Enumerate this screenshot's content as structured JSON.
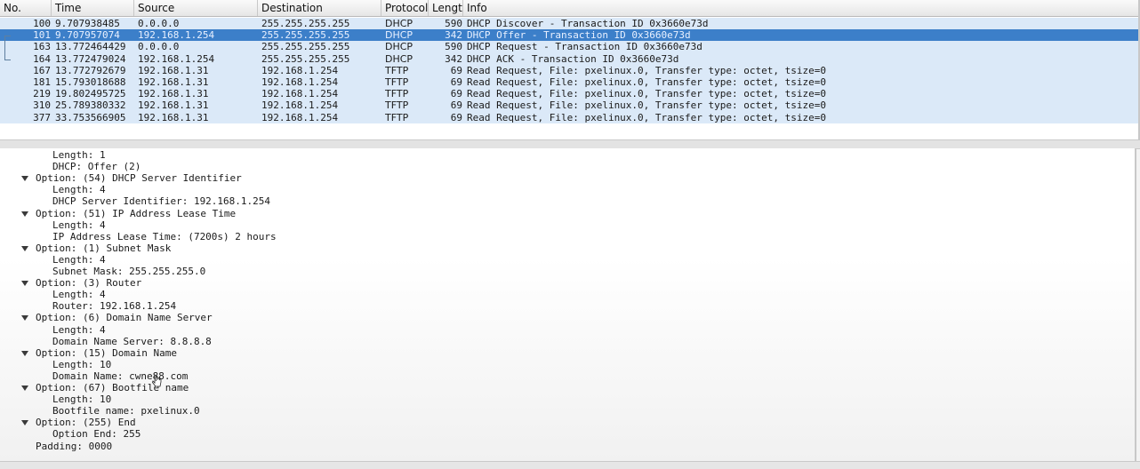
{
  "packet_list": {
    "columns": [
      "No.",
      "Time",
      "Source",
      "Destination",
      "Protocol",
      "Length",
      "Info"
    ],
    "rows": [
      {
        "no": "100",
        "time": "9.707938485",
        "src": "0.0.0.0",
        "dst": "255.255.255.255",
        "proto": "DHCP",
        "len": "590",
        "info": "DHCP Discover - Transaction ID 0x3660e73d"
      },
      {
        "no": "101",
        "time": "9.707957074",
        "src": "192.168.1.254",
        "dst": "255.255.255.255",
        "proto": "DHCP",
        "len": "342",
        "info": "DHCP Offer    - Transaction ID 0x3660e73d"
      },
      {
        "no": "163",
        "time": "13.772464429",
        "src": "0.0.0.0",
        "dst": "255.255.255.255",
        "proto": "DHCP",
        "len": "590",
        "info": "DHCP Request  - Transaction ID 0x3660e73d"
      },
      {
        "no": "164",
        "time": "13.772479024",
        "src": "192.168.1.254",
        "dst": "255.255.255.255",
        "proto": "DHCP",
        "len": "342",
        "info": "DHCP ACK      - Transaction ID 0x3660e73d"
      },
      {
        "no": "167",
        "time": "13.772792679",
        "src": "192.168.1.31",
        "dst": "192.168.1.254",
        "proto": "TFTP",
        "len": "69",
        "info": "Read Request, File: pxelinux.0, Transfer type: octet, tsize=0"
      },
      {
        "no": "181",
        "time": "15.793018688",
        "src": "192.168.1.31",
        "dst": "192.168.1.254",
        "proto": "TFTP",
        "len": "69",
        "info": "Read Request, File: pxelinux.0, Transfer type: octet, tsize=0"
      },
      {
        "no": "219",
        "time": "19.802495725",
        "src": "192.168.1.31",
        "dst": "192.168.1.254",
        "proto": "TFTP",
        "len": "69",
        "info": "Read Request, File: pxelinux.0, Transfer type: octet, tsize=0"
      },
      {
        "no": "310",
        "time": "25.789380332",
        "src": "192.168.1.31",
        "dst": "192.168.1.254",
        "proto": "TFTP",
        "len": "69",
        "info": "Read Request, File: pxelinux.0, Transfer type: octet, tsize=0"
      },
      {
        "no": "377",
        "time": "33.753566905",
        "src": "192.168.1.31",
        "dst": "192.168.1.254",
        "proto": "TFTP",
        "len": "69",
        "info": "Read Request, File: pxelinux.0, Transfer type: octet, tsize=0"
      }
    ],
    "selected_row": 1
  },
  "details": [
    {
      "level": 2,
      "expander": false,
      "text": "Length: 1"
    },
    {
      "level": 2,
      "expander": false,
      "text": "DHCP: Offer (2)"
    },
    {
      "level": 1,
      "expander": true,
      "text": "Option: (54) DHCP Server Identifier"
    },
    {
      "level": 2,
      "expander": false,
      "text": "Length: 4"
    },
    {
      "level": 2,
      "expander": false,
      "text": "DHCP Server Identifier: 192.168.1.254"
    },
    {
      "level": 1,
      "expander": true,
      "text": "Option: (51) IP Address Lease Time"
    },
    {
      "level": 2,
      "expander": false,
      "text": "Length: 4"
    },
    {
      "level": 2,
      "expander": false,
      "text": "IP Address Lease Time: (7200s) 2 hours"
    },
    {
      "level": 1,
      "expander": true,
      "text": "Option: (1) Subnet Mask"
    },
    {
      "level": 2,
      "expander": false,
      "text": "Length: 4"
    },
    {
      "level": 2,
      "expander": false,
      "text": "Subnet Mask: 255.255.255.0"
    },
    {
      "level": 1,
      "expander": true,
      "text": "Option: (3) Router"
    },
    {
      "level": 2,
      "expander": false,
      "text": "Length: 4"
    },
    {
      "level": 2,
      "expander": false,
      "text": "Router: 192.168.1.254"
    },
    {
      "level": 1,
      "expander": true,
      "text": "Option: (6) Domain Name Server"
    },
    {
      "level": 2,
      "expander": false,
      "text": "Length: 4"
    },
    {
      "level": 2,
      "expander": false,
      "text": "Domain Name Server: 8.8.8.8"
    },
    {
      "level": 1,
      "expander": true,
      "text": "Option: (15) Domain Name"
    },
    {
      "level": 2,
      "expander": false,
      "text": "Length: 10"
    },
    {
      "level": 2,
      "expander": false,
      "text": "Domain Name: cwne88.com"
    },
    {
      "level": 1,
      "expander": true,
      "text": "Option: (67) Bootfile name"
    },
    {
      "level": 2,
      "expander": false,
      "text": "Length: 10"
    },
    {
      "level": 2,
      "expander": false,
      "text": "Bootfile name: pxelinux.0"
    },
    {
      "level": 1,
      "expander": true,
      "text": "Option: (255) End"
    },
    {
      "level": 2,
      "expander": false,
      "text": "Option End: 255"
    },
    {
      "level": 1,
      "expander": false,
      "text": "Padding: 0000"
    }
  ],
  "colors": {
    "row_bg": "#dbe9f8",
    "selected_bg": "#3c7fc9",
    "selected_fg": "#e8f0ff"
  }
}
